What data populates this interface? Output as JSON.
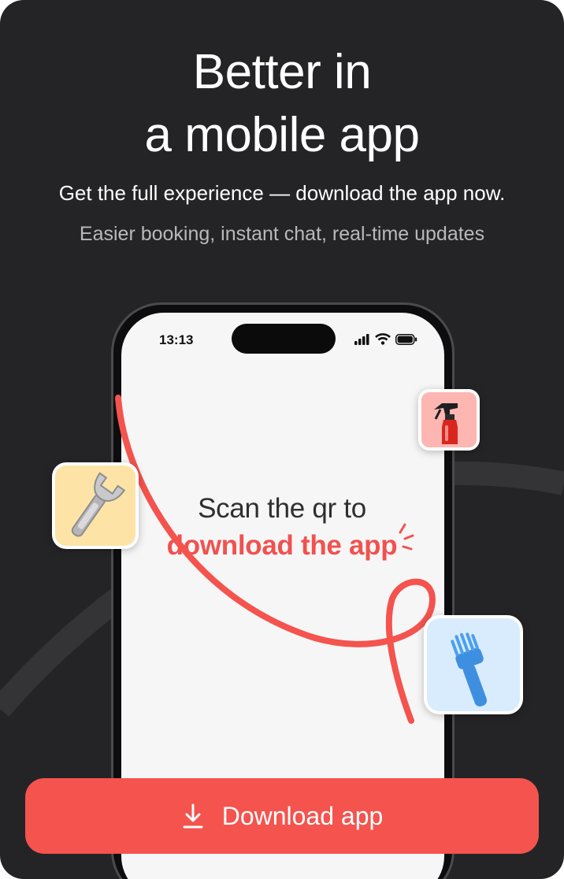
{
  "headline": {
    "line1": "Better in",
    "line2": "a mobile app"
  },
  "subtitle": "Get the full experience — download the app now.",
  "features": "Easier booking, instant chat, real-time updates",
  "phone": {
    "time": "13:13",
    "scan_text": "Scan the qr to",
    "scan_highlight": "download the app"
  },
  "icons": {
    "spray": "spray-bottle-icon",
    "wrench": "wrench-icon",
    "brush": "cleaning-brush-icon"
  },
  "button": {
    "label": "Download app"
  },
  "colors": {
    "background": "#242426",
    "accent": "#f4534e",
    "screen": "#f6f6f6"
  }
}
